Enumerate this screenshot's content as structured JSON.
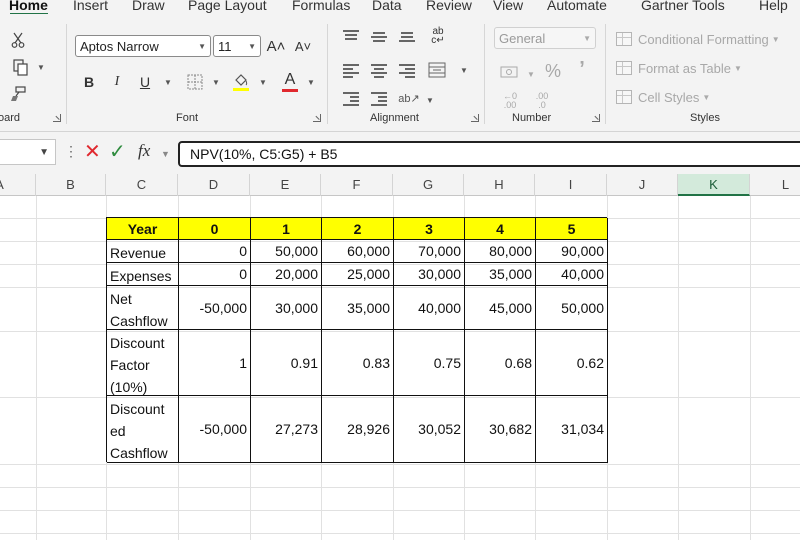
{
  "ribbon_tabs": [
    "Home",
    "Insert",
    "Draw",
    "Page Layout",
    "Formulas",
    "Data",
    "Review",
    "View",
    "Automate",
    "Gartner Tools",
    "Help"
  ],
  "groups": {
    "clipboard": "oard",
    "font": "Font",
    "alignment": "Alignment",
    "number": "Number",
    "styles": "Styles"
  },
  "font_name": "Aptos Narrow",
  "font_size": "11",
  "number_format": "General",
  "styles_buttons": {
    "conditional": "Conditional Formatting",
    "format_table": "Format as Table",
    "cell_styles": "Cell Styles"
  },
  "font_buttons": {
    "bold": "B",
    "italic": "I",
    "underline": "U",
    "grow": "A˄",
    "shrink": "A˅",
    "font_color": "A"
  },
  "number_buttons": {
    "percent": "%",
    "comma": "’",
    "inc_decimal": ".00",
    "dec_decimal": ".0"
  },
  "formula_bar": {
    "fx": "fx",
    "formula": "NPV(10%, C5:G5) + B5"
  },
  "columns": [
    "A",
    "B",
    "C",
    "D",
    "E",
    "F",
    "G",
    "H",
    "I",
    "J",
    "K",
    "L"
  ],
  "colors": {
    "accent": "#217346",
    "header_fill": "#ffff00",
    "cancel": "#e0282e",
    "enter": "#2e8b3e",
    "font_color_bar": "#e0282e"
  },
  "table": {
    "header": [
      "Year",
      "0",
      "1",
      "2",
      "3",
      "4",
      "5"
    ],
    "rows": [
      {
        "label": [
          "Revenue"
        ],
        "values": [
          "0",
          "50,000",
          "60,000",
          "70,000",
          "80,000",
          "90,000"
        ]
      },
      {
        "label": [
          "Expenses"
        ],
        "values": [
          "0",
          "20,000",
          "25,000",
          "30,000",
          "35,000",
          "40,000"
        ]
      },
      {
        "label": [
          "Net",
          "Cashflow"
        ],
        "values": [
          "-50,000",
          "30,000",
          "35,000",
          "40,000",
          "45,000",
          "50,000"
        ]
      },
      {
        "label": [
          "Discount",
          "Factor",
          "(10%)"
        ],
        "values": [
          "1",
          "0.91",
          "0.83",
          "0.75",
          "0.68",
          "0.62"
        ]
      },
      {
        "label": [
          "Discount",
          "ed",
          "Cashflow"
        ],
        "values": [
          "-50,000",
          "27,273",
          "28,926",
          "30,052",
          "30,682",
          "31,034"
        ]
      }
    ]
  }
}
